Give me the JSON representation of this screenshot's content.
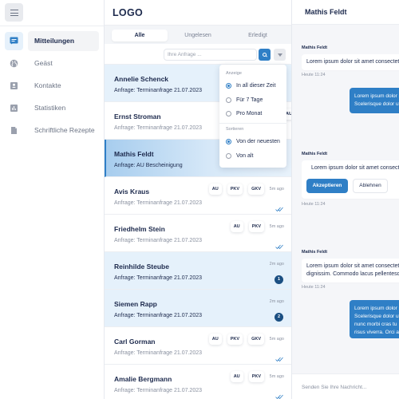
{
  "sidebar": {
    "menu_icon": "hamburger-icon",
    "items": [
      {
        "label": "Mitteilungen",
        "icon": "message-icon",
        "active": true
      },
      {
        "label": "Geäst",
        "icon": "globe-icon",
        "active": false
      },
      {
        "label": "Kontakte",
        "icon": "contact-card-icon",
        "active": false
      },
      {
        "label": "Statistiken",
        "icon": "bar-chart-icon",
        "active": false
      },
      {
        "label": "Schriftliche Rezepte",
        "icon": "document-icon",
        "active": false
      }
    ]
  },
  "list": {
    "logo": "LOGO",
    "tabs": [
      {
        "label": "Alle",
        "active": true
      },
      {
        "label": "Ungelesen",
        "active": false
      },
      {
        "label": "Erledigt",
        "active": false
      }
    ],
    "search": {
      "placeholder": "Ihre Anfrage ...",
      "value": ""
    },
    "rows": [
      {
        "name": "Annelie Schenck",
        "subject": "Anfrage: Terminanfrage 21.07.2023",
        "state": "unread",
        "tags": [],
        "time": "",
        "status": "none"
      },
      {
        "name": "Ernst Stroman",
        "subject": "Anfrage: Terminanfrage 21.07.2023",
        "state": "read",
        "tags": [
          "AU"
        ],
        "time": "",
        "status": "none"
      },
      {
        "name": "Mathis Feldt",
        "subject": "Anfrage: AU Bescheinigung",
        "state": "selected",
        "tags": [],
        "time": "",
        "status": "none"
      },
      {
        "name": "Avis Kraus",
        "subject": "Anfrage: Terminanfrage 21.07.2023",
        "state": "read",
        "tags": [
          "AU",
          "PKV",
          "GKV"
        ],
        "time": "5m ago",
        "status": "read-check"
      },
      {
        "name": "Friedhelm Stein",
        "subject": "Anfrage: Terminanfrage 21.07.2023",
        "state": "read",
        "tags": [
          "AU",
          "PKV"
        ],
        "time": "5m ago",
        "status": "read-check"
      },
      {
        "name": "Reinhilde Steube",
        "subject": "Anfrage: Terminanfrage 21.07.2023",
        "state": "unread",
        "tags": [],
        "time": "2m ago",
        "status": "badge",
        "badge": "1"
      },
      {
        "name": "Siemen Rapp",
        "subject": "Anfrage: Terminanfrage 21.07.2023",
        "state": "unread",
        "tags": [],
        "time": "2m ago",
        "status": "badge",
        "badge": "2"
      },
      {
        "name": "Carl Gorman",
        "subject": "Anfrage: Terminanfrage 21.07.2023",
        "state": "read",
        "tags": [
          "AU",
          "PKV",
          "GKV"
        ],
        "time": "5m ago",
        "status": "read-check"
      },
      {
        "name": "Amalie Bergmann",
        "subject": "Anfrage: Terminanfrage 21.07.2023",
        "state": "read",
        "tags": [
          "AU",
          "PKV"
        ],
        "time": "5m ago",
        "status": "read-check"
      }
    ]
  },
  "filter_menu": {
    "display_heading": "Anzeige",
    "display_options": [
      {
        "label": "In all dieser Zeit",
        "selected": true
      },
      {
        "label": "Für 7 Tage",
        "selected": false
      },
      {
        "label": "Pro Monat",
        "selected": false
      }
    ],
    "sort_heading": "Sortieren",
    "sort_options": [
      {
        "label": "Von der neuesten",
        "selected": true
      },
      {
        "label": "Von alt",
        "selected": false
      }
    ]
  },
  "chat": {
    "title": "Mathis Feldt",
    "messages": [
      {
        "direction": "in",
        "sender": "Mathis Feldt",
        "lines": [
          "Lorem ipsum dolor sit amet consectetur"
        ],
        "time": "Heute 11:24"
      },
      {
        "direction": "out",
        "lines": [
          "Lorem ipsum dolor sit",
          "Scelerisque dolor ut"
        ]
      },
      {
        "direction": "in",
        "sender": "Mathis Feldt",
        "lines": [
          "Lorem ipsum dolor sit amet consectetur"
        ],
        "time": "Heute 11:24",
        "actions": {
          "accept": "Akzeptieren",
          "decline": "Ablehnen"
        }
      },
      {
        "direction": "in",
        "sender": "Mathis Feldt",
        "lines": [
          "Lorem ipsum dolor sit amet consectetur",
          "dignissim. Commodo lacus pellentesque"
        ],
        "time": "Heute 11:24"
      },
      {
        "direction": "out",
        "lines": [
          "Lorem ipsum dolor sit",
          "Scelerisque dolor ut",
          "nunc morbi cras tu",
          "risus viverra. Orci a"
        ]
      }
    ],
    "compose_placeholder": "Senden Sie Ihre Nachricht..."
  },
  "colors": {
    "accent": "#2f7fc6",
    "badge": "#1b4f82",
    "unread_row": "#e5f1fb",
    "text": "#1d2a4d"
  }
}
